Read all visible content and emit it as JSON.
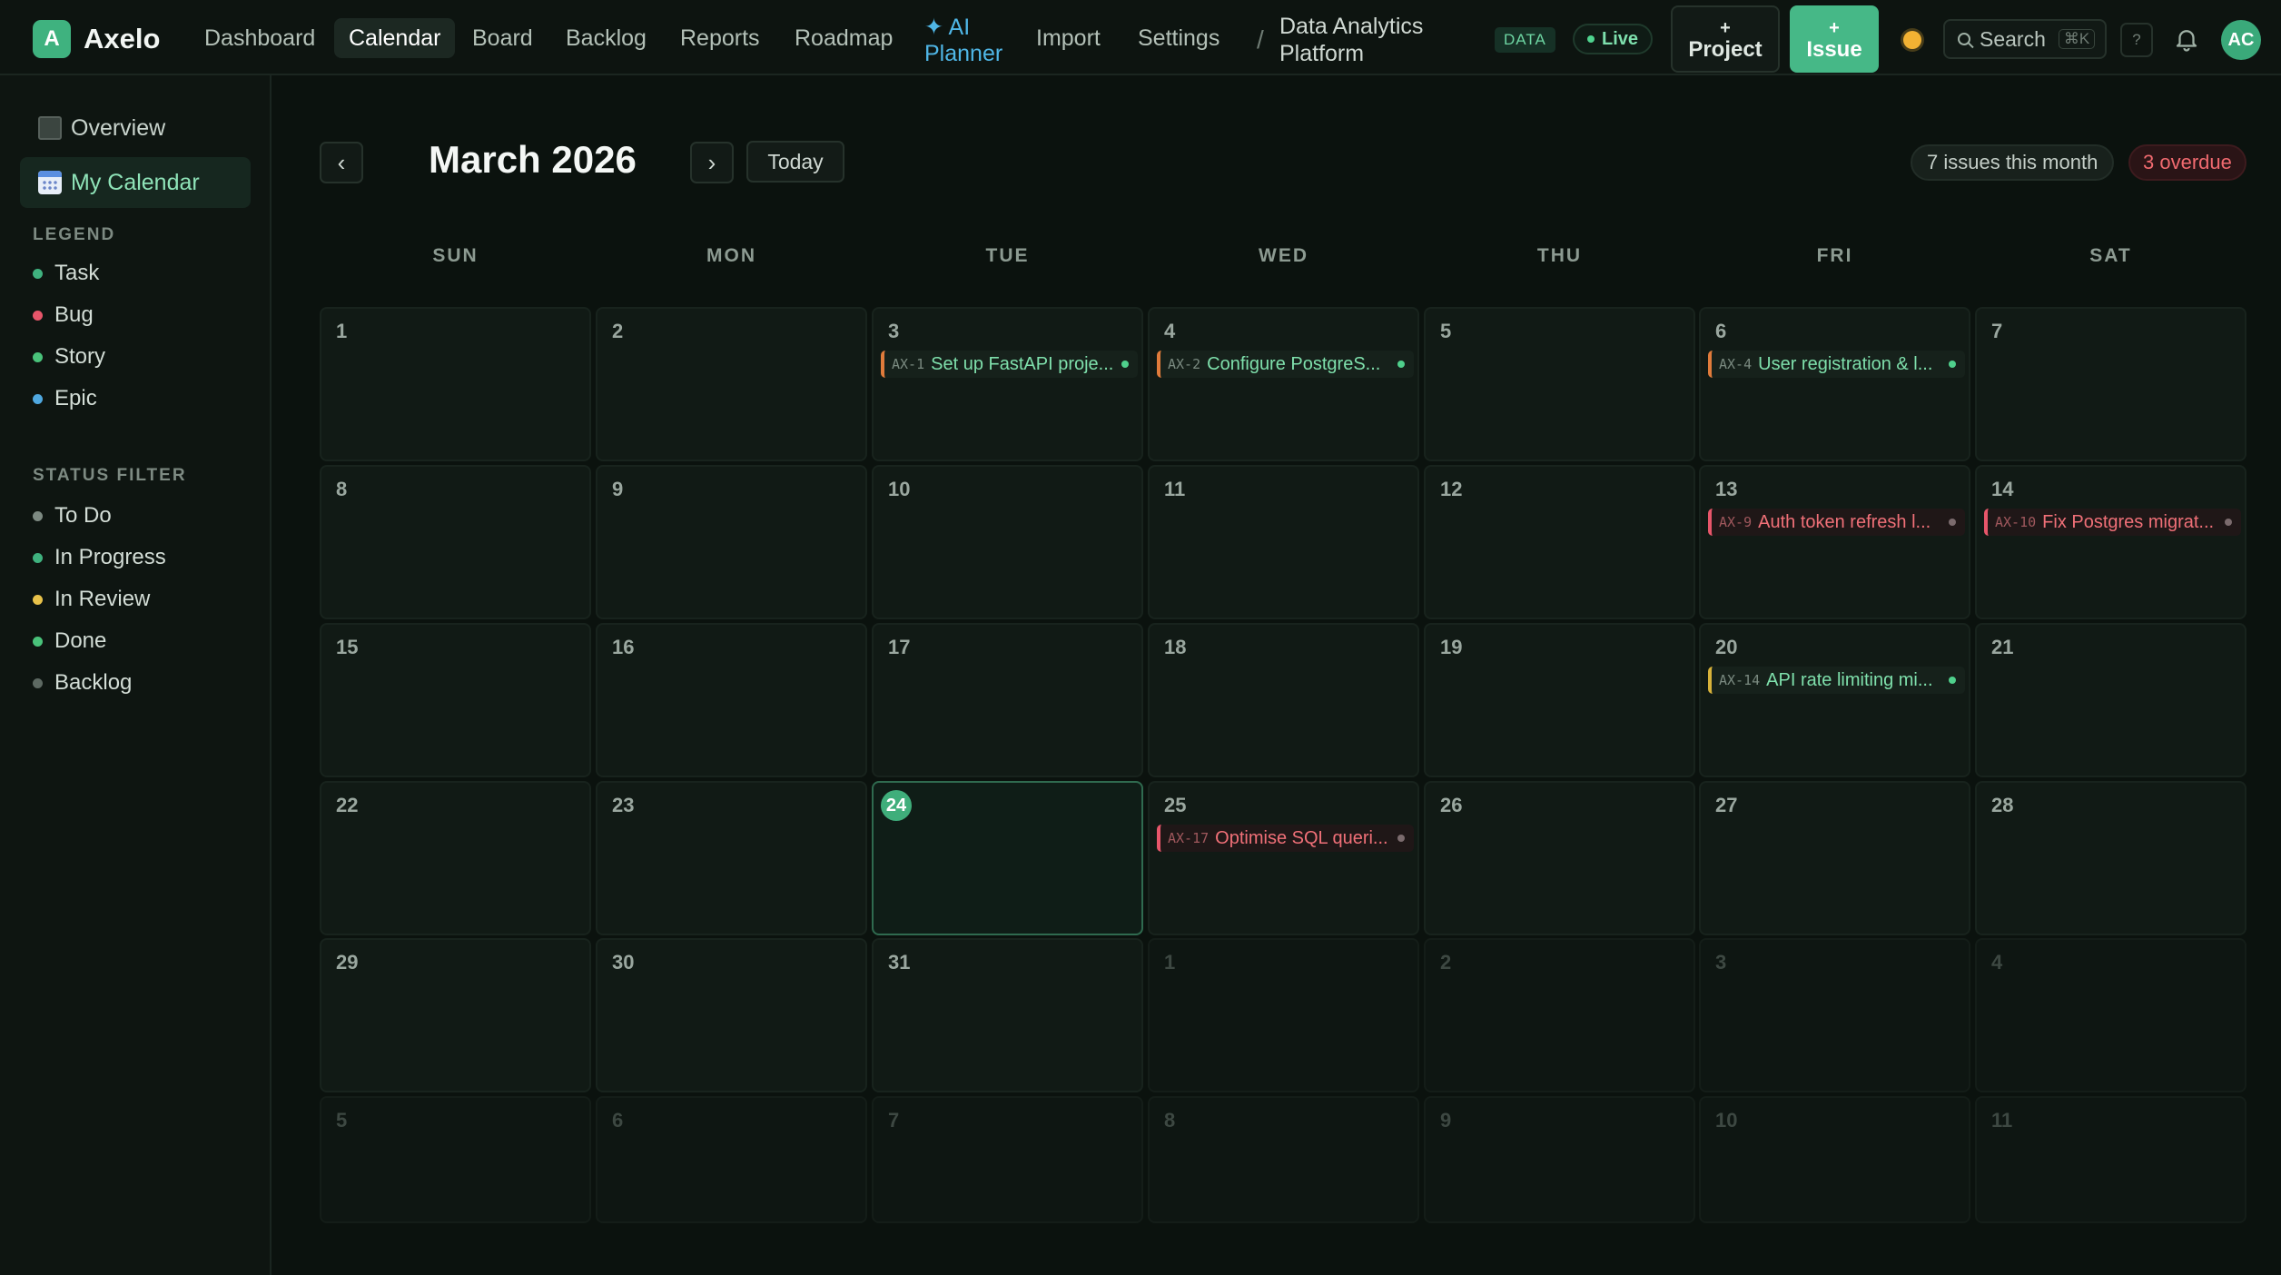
{
  "app": {
    "logo_letter": "A",
    "name": "Axelo"
  },
  "nav": {
    "items": [
      "Dashboard",
      "Calendar",
      "Board",
      "Backlog",
      "Reports",
      "Roadmap"
    ],
    "ai_planner": "✦ AI Planner",
    "import": "Import",
    "settings": "Settings",
    "separator": "/",
    "project_name": "Data Analytics Platform",
    "project_badge": "DATA",
    "live_label": "Live"
  },
  "actions": {
    "project_plus": "+",
    "project_label": "Project",
    "issue_plus": "+",
    "issue_label": "Issue",
    "search_label": "Search",
    "search_shortcut": "⌘K",
    "help_label": "?",
    "avatar_initials": "AC"
  },
  "sidebar": {
    "overview": "Overview",
    "my_calendar": "My Calendar",
    "legend_heading": "LEGEND",
    "legend": [
      {
        "label": "Task",
        "color": "#3fb27f"
      },
      {
        "label": "Bug",
        "color": "#e7566a"
      },
      {
        "label": "Story",
        "color": "#49c27a"
      },
      {
        "label": "Epic",
        "color": "#4fa8e0"
      }
    ],
    "status_heading": "STATUS FILTER",
    "statuses": [
      {
        "label": "To Do",
        "color": "#7d8a82"
      },
      {
        "label": "In Progress",
        "color": "#3fb27f"
      },
      {
        "label": "In Review",
        "color": "#e8c24a"
      },
      {
        "label": "Done",
        "color": "#49c27a"
      },
      {
        "label": "Backlog",
        "color": "#5d6962"
      }
    ]
  },
  "calendar": {
    "prev": "‹",
    "next": "›",
    "month_title": "March 2026",
    "today_label": "Today",
    "issues_count": "7 issues this month",
    "overdue_count": "3 overdue",
    "weekdays": [
      "SUN",
      "MON",
      "TUE",
      "WED",
      "THU",
      "FRI",
      "SAT"
    ],
    "days": [
      "1",
      "2",
      "3",
      "4",
      "5",
      "6",
      "7",
      "8",
      "9",
      "10",
      "11",
      "12",
      "13",
      "14",
      "15",
      "16",
      "17",
      "18",
      "19",
      "20",
      "21",
      "22",
      "23",
      "24",
      "25",
      "26",
      "27",
      "28",
      "29",
      "30",
      "31",
      "1",
      "2",
      "3",
      "4",
      "5",
      "6",
      "7",
      "8",
      "9",
      "10",
      "11"
    ],
    "events": [
      {
        "key": "AX-1",
        "title": "Set up FastAPI proje...",
        "style": "orange"
      },
      {
        "key": "AX-2",
        "title": "Configure PostgreS...",
        "style": "orange"
      },
      {
        "key": "AX-4",
        "title": "User registration & l...",
        "style": "orange"
      },
      {
        "key": "AX-9",
        "title": "Auth token refresh l...",
        "style": "red"
      },
      {
        "key": "AX-10",
        "title": "Fix Postgres migrat...",
        "style": "red"
      },
      {
        "key": "AX-14",
        "title": "API rate limiting mi...",
        "style": "yellow"
      },
      {
        "key": "AX-17",
        "title": "Optimise SQL queri...",
        "style": "red"
      }
    ]
  }
}
